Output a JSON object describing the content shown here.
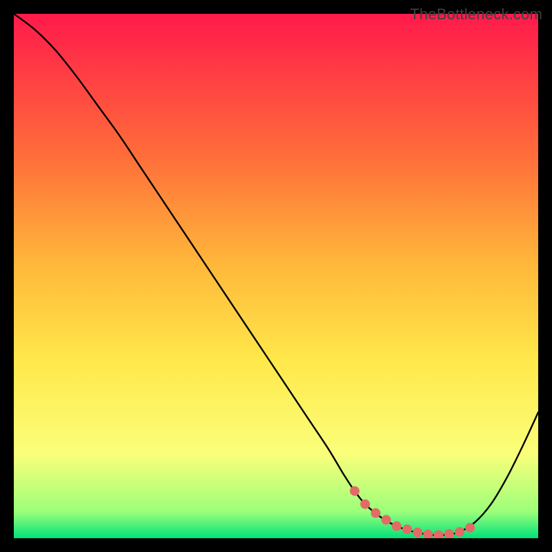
{
  "watermark": "TheBottleneck.com",
  "colors": {
    "bg": "#000000",
    "grad_top": "#ff1a4b",
    "grad_mid1": "#ff6a3a",
    "grad_mid2": "#ffb83a",
    "grad_mid3": "#ffe84a",
    "grad_mid4": "#faff7a",
    "grad_bottom1": "#9bff7a",
    "grad_bottom2": "#00e27a",
    "curve": "#000000",
    "marker": "#e26b66"
  },
  "chart_data": {
    "type": "line",
    "title": "",
    "xlabel": "",
    "ylabel": "",
    "xlim": [
      0,
      100
    ],
    "ylim": [
      0,
      100
    ],
    "series": [
      {
        "name": "bottleneck-curve",
        "x": [
          0,
          4,
          8,
          12,
          16,
          20,
          24,
          28,
          32,
          36,
          40,
          44,
          48,
          52,
          56,
          60,
          63,
          65,
          67,
          70,
          73,
          76,
          79,
          82,
          85,
          88,
          91,
          94,
          97,
          100
        ],
        "y": [
          100,
          97,
          93,
          88,
          82.5,
          77,
          71,
          65,
          59,
          53,
          47,
          41,
          35,
          29,
          23,
          17,
          12,
          9,
          6.5,
          4,
          2.3,
          1.3,
          0.7,
          0.6,
          1.2,
          3.1,
          6.5,
          11.5,
          17.5,
          24
        ]
      }
    ],
    "markers": {
      "name": "optimal-range",
      "x": [
        65,
        67,
        69,
        71,
        73,
        75,
        77,
        79,
        81,
        83,
        85,
        87
      ],
      "y": [
        9,
        6.5,
        4.8,
        3.5,
        2.3,
        1.7,
        1.1,
        0.7,
        0.6,
        0.8,
        1.2,
        2.0
      ]
    }
  }
}
